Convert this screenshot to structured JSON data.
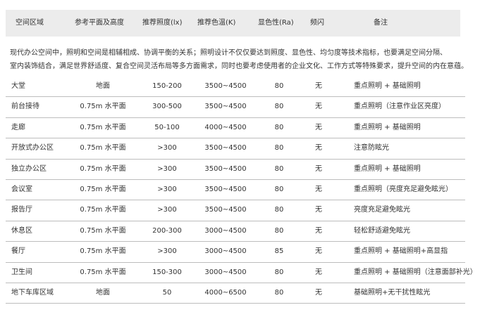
{
  "header": {
    "space": "空间区域",
    "plane": "参考平面及高度",
    "lux": "推荐照度(lx)",
    "temp": "推荐色温(K)",
    "ra": "显色性(Ra)",
    "flicker": "频闪",
    "note": "备注"
  },
  "intro": {
    "line1": "现代办公空间中，照明和空间是相辅相成、协调平衡的关系；照明设计不仅仅要达到照度、显色性、均匀度等技术指标，也要满足空间分隔、",
    "line2": "室内装饰结合，满足世界舒适度、复合空间灵活布局等多方面需求，同时也要考虑使用者的企业文化、工作方式等特殊要求，提升空间的内在意蕴。"
  },
  "rows": [
    {
      "space": "大堂",
      "plane": "地面",
      "lux": "150-200",
      "temp": "3500~4500",
      "ra": "80",
      "flicker": "无",
      "note": "重点照明 + 基础照明"
    },
    {
      "space": "前台接待",
      "plane": "0.75m 水平面",
      "lux": "300-500",
      "temp": "3500~4500",
      "ra": "80",
      "flicker": "无",
      "note": "重点照明（注意作业区亮度）"
    },
    {
      "space": "走廊",
      "plane": "0.75m 水平面",
      "lux": "50-100",
      "temp": "4000~4500",
      "ra": "80",
      "flicker": "无",
      "note": "重点照明 + 基础照明"
    },
    {
      "space": "开放式办公区",
      "plane": "0.75m 水平面",
      "lux": ">300",
      "temp": "3500~4500",
      "ra": "80",
      "flicker": "无",
      "note": "注意防眩光"
    },
    {
      "space": "独立办公区",
      "plane": "0.75m 水平面",
      "lux": ">300",
      "temp": "3500~4500",
      "ra": "80",
      "flicker": "无",
      "note": "重点照明 + 基础照明"
    },
    {
      "space": "会议室",
      "plane": "0.75m 水平面",
      "lux": ">300",
      "temp": "3500~4500",
      "ra": "80",
      "flicker": "无",
      "note": "重点照明（亮度充足避免眩光）"
    },
    {
      "space": "报告厅",
      "plane": "0.75m 水平面",
      "lux": ">300",
      "temp": "3500~4500",
      "ra": "80",
      "flicker": "无",
      "note": "亮度充足避免眩光"
    },
    {
      "space": "休息区",
      "plane": "0.75m 水平面",
      "lux": "200-300",
      "temp": "3000~4500",
      "ra": "80",
      "flicker": "无",
      "note": "轻松舒适避免眩光"
    },
    {
      "space": "餐厅",
      "plane": "0.75m 水平面",
      "lux": ">300",
      "temp": "3000~4500",
      "ra": "85",
      "flicker": "无",
      "note": "重点照明 + 基础照明+高显指"
    },
    {
      "space": "卫生间",
      "plane": "0.75m 水平面",
      "lux": "150-300",
      "temp": "3000~4500",
      "ra": "80",
      "flicker": "无",
      "note": "重点照明 + 基础照明（注意面部补光）"
    },
    {
      "space": "地下车库区域",
      "plane": "地面",
      "lux": "50",
      "temp": "4000~6500",
      "ra": "80",
      "flicker": "无",
      "note": "基础照明+无干扰性眩光"
    }
  ]
}
